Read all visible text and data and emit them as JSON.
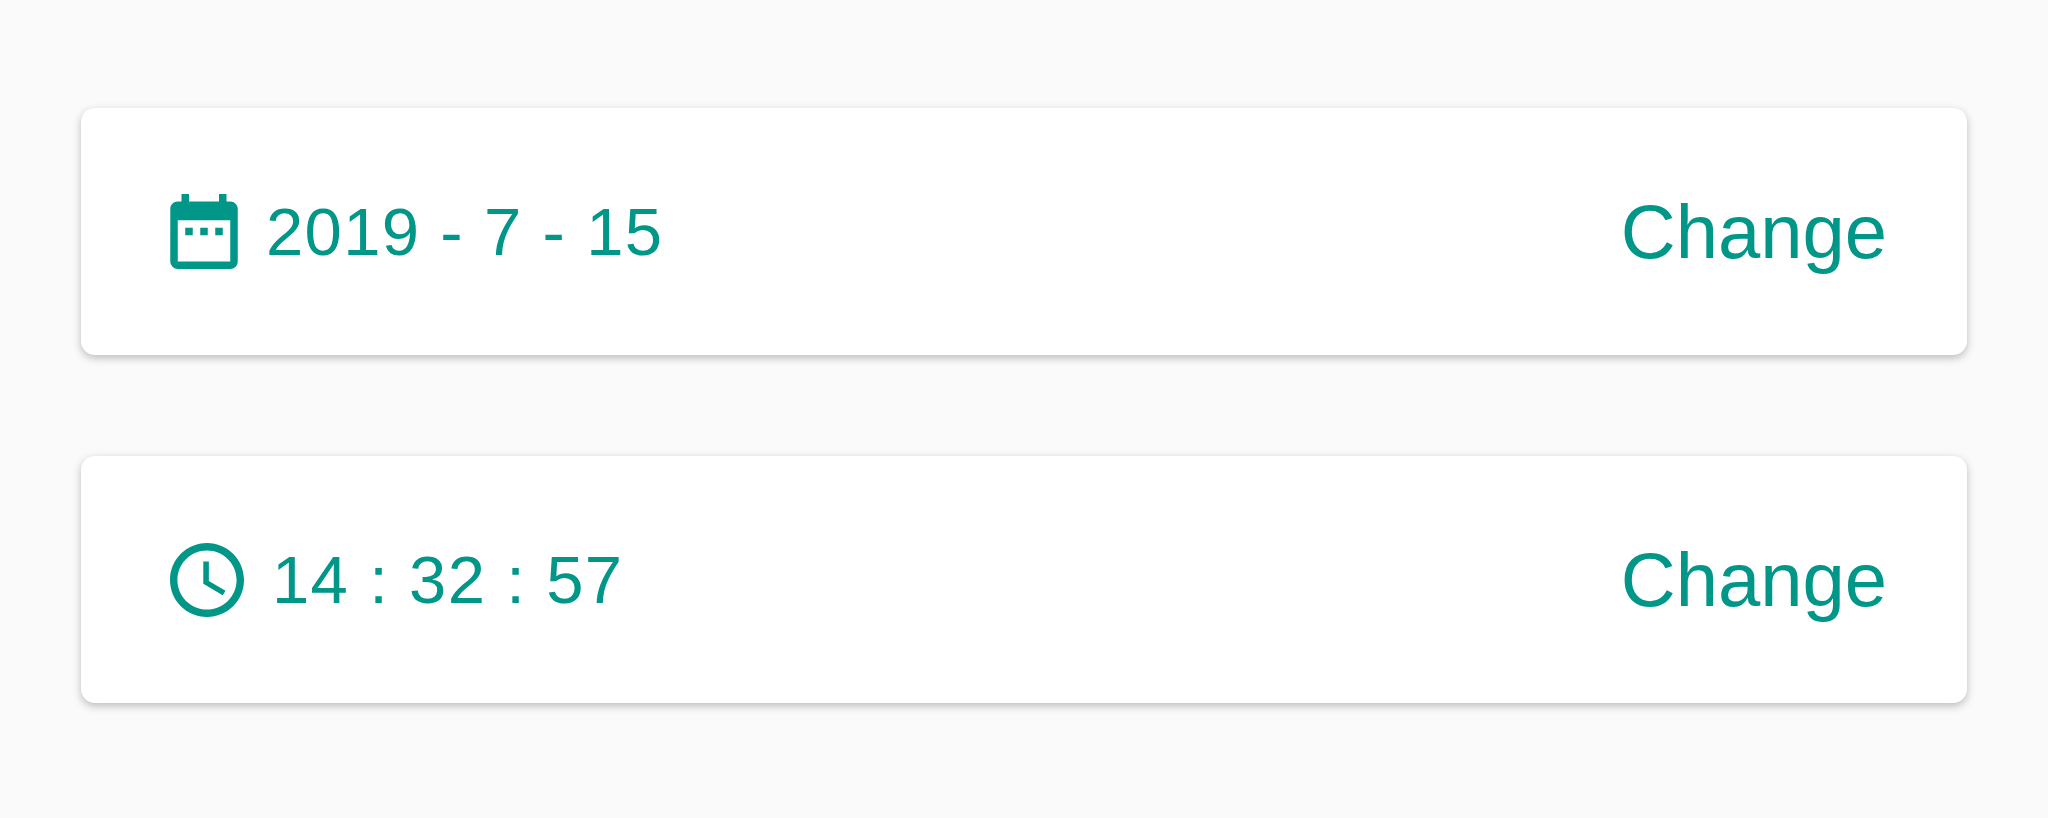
{
  "rows": [
    {
      "kind": "date",
      "value": "2019 - 7 - 15",
      "action": "Change"
    },
    {
      "kind": "time",
      "value": "14 : 32 : 57",
      "action": "Change"
    }
  ]
}
